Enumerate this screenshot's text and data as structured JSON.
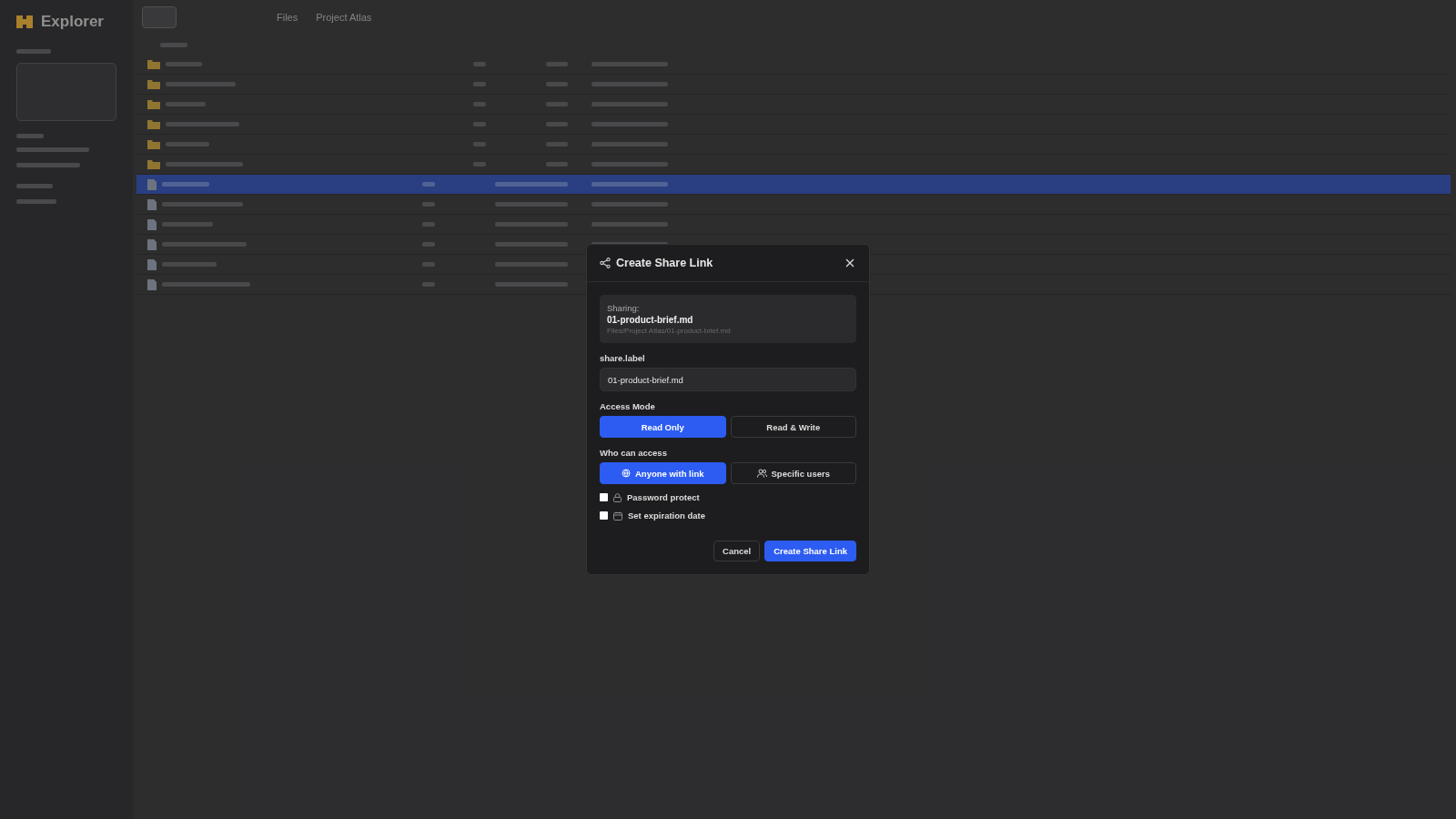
{
  "app": {
    "title": "Explorer"
  },
  "breadcrumb": [
    "Files",
    "Project Atlas"
  ],
  "rows": [
    {
      "kind": "folder",
      "selected": false
    },
    {
      "kind": "folder",
      "selected": false
    },
    {
      "kind": "folder",
      "selected": false
    },
    {
      "kind": "folder",
      "selected": false
    },
    {
      "kind": "folder",
      "selected": false
    },
    {
      "kind": "folder",
      "selected": false
    },
    {
      "kind": "file",
      "selected": true
    },
    {
      "kind": "file",
      "selected": false
    },
    {
      "kind": "file",
      "selected": false
    },
    {
      "kind": "file",
      "selected": false
    },
    {
      "kind": "file",
      "selected": false
    },
    {
      "kind": "file",
      "selected": false
    }
  ],
  "dialog": {
    "title": "Create Share Link",
    "sharing": {
      "caption": "Sharing:",
      "name": "01-product-brief.md",
      "path": "Files/Project Atlas/01-product-brief.md"
    },
    "label_field": {
      "label": "share.label",
      "value": "01-product-brief.md"
    },
    "access_mode": {
      "label": "Access Mode",
      "options": [
        {
          "label": "Read Only",
          "selected": true
        },
        {
          "label": "Read & Write",
          "selected": false
        }
      ]
    },
    "who": {
      "label": "Who can access",
      "options": [
        {
          "label": "Anyone with link",
          "kind": "globe",
          "selected": true
        },
        {
          "label": "Specific users",
          "kind": "users",
          "selected": false
        }
      ]
    },
    "options": [
      {
        "label": "Password protect",
        "kind": "lock",
        "checked": false
      },
      {
        "label": "Set expiration date",
        "kind": "calendar",
        "checked": false
      }
    ],
    "buttons": [
      {
        "label": "Cancel",
        "kind": "secondary"
      },
      {
        "label": "Create Share Link",
        "kind": "primary"
      }
    ]
  }
}
